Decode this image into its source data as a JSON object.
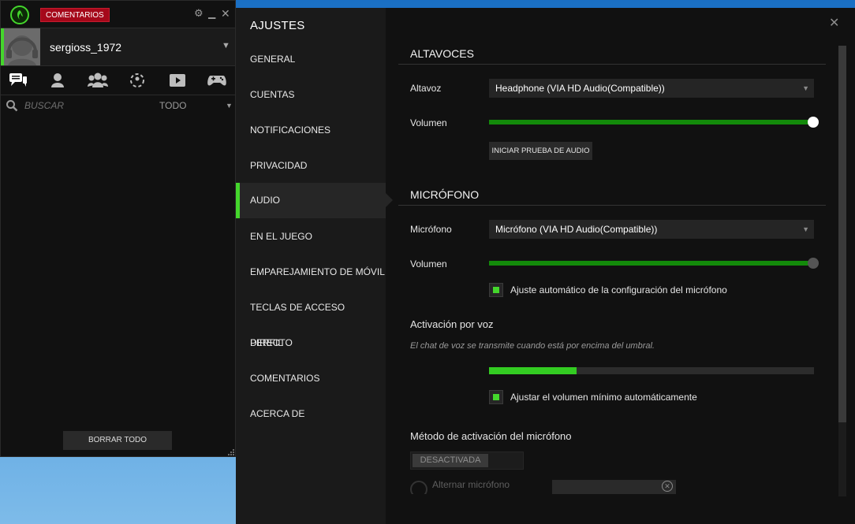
{
  "left_panel": {
    "feedback_badge": "COMENTARIOS",
    "username": "sergioss_1972",
    "tabs": [
      "chat-icon",
      "friend-icon",
      "group-icon",
      "game-icon-unknown",
      "video-icon",
      "gamepad-icon"
    ],
    "search": {
      "placeholder": "BUSCAR"
    },
    "filter": "TODO",
    "clear_all": "BORRAR TODO"
  },
  "settings": {
    "title": "AJUSTES",
    "nav": [
      "GENERAL",
      "CUENTAS",
      "NOTIFICACIONES",
      "PRIVACIDAD",
      "AUDIO",
      "EN EL JUEGO",
      "EMPAREJAMIENTO DE MÓVIL",
      "TECLAS DE ACCESO DIRECTO",
      "PERFIL",
      "COMENTARIOS",
      "ACERCA DE"
    ],
    "active_nav": "AUDIO",
    "speakers": {
      "heading": "ALTAVOCES",
      "device_label": "Altavoz",
      "device_value": "Headphone (VIA HD Audio(Compatible))",
      "volume_label": "Volumen",
      "volume_level": 1.0,
      "test_button": "INICIAR PRUEBA DE AUDIO"
    },
    "microphone": {
      "heading": "MICRÓFONO",
      "device_label": "Micrófono",
      "device_value": "Micrófono (VIA HD Audio(Compatible))",
      "volume_label": "Volumen",
      "volume_level": 1.0,
      "auto_adjust_label": "Ajuste automático de la configuración del micrófono",
      "auto_adjust_checked": true
    },
    "voice_activation": {
      "heading": "Activación por voz",
      "description": "El chat de voz se transmite cuando está por encima del umbral.",
      "threshold_level": 0.27,
      "auto_min_label": "Ajustar el volumen mínimo automáticamente",
      "auto_min_checked": true
    },
    "activation_method": {
      "heading": "Método de activación del micrófono",
      "mode": "DESACTIVADA",
      "toggle_label": "Alternar micrófono"
    }
  },
  "colors": {
    "accent_green": "#44d62c",
    "slider_green": "#138a0a",
    "badge_red": "#a5081a"
  }
}
